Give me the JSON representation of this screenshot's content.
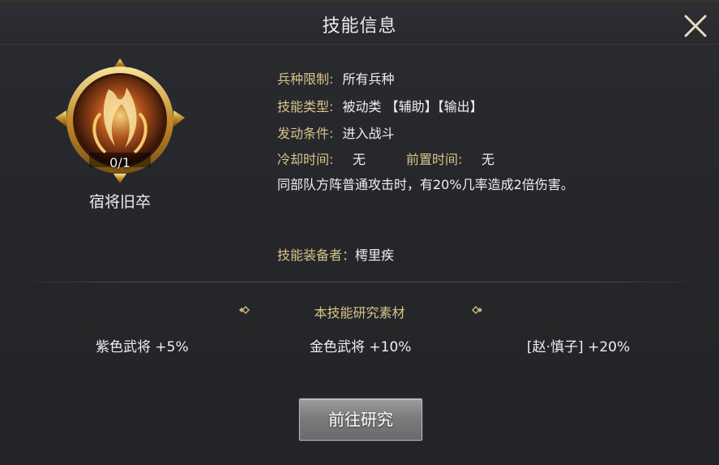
{
  "dialog": {
    "title": "技能信息"
  },
  "skill": {
    "name": "宿将旧卒",
    "level": "0/1"
  },
  "info": {
    "unit_limit_label": "兵种限制:",
    "unit_limit_value": "所有兵种",
    "skill_type_label": "技能类型:",
    "skill_type_value": "被动类 【辅助】【输出】",
    "trigger_label": "发动条件:",
    "trigger_value": "进入战斗",
    "cooldown_label": "冷却时间:",
    "cooldown_value": "无",
    "prep_label": "前置时间:",
    "prep_value": "无",
    "description": "同部队方阵普通攻击时，有20%几率造成2倍伤害。",
    "equipper_label": "技能装备者：",
    "equipper_value": "樗里疾"
  },
  "materials": {
    "title": "本技能研究素材",
    "items": [
      {
        "label": "紫色武将 +5%"
      },
      {
        "label": "金色武将 +10%"
      },
      {
        "label": "[赵·慎子] +20%"
      }
    ]
  },
  "actions": {
    "research_label": "前往研究"
  },
  "colors": {
    "label_gold": "#d7c48a",
    "text": "#efefef",
    "background": "#26272a"
  }
}
